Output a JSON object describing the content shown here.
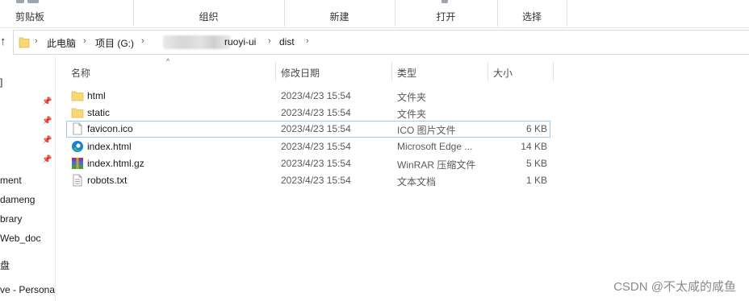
{
  "ribbon": {
    "groups": [
      {
        "label": "剪贴板"
      },
      {
        "label": "组织"
      },
      {
        "label": "新建"
      },
      {
        "label": "打开"
      },
      {
        "label": "选择"
      }
    ]
  },
  "address": {
    "crumbs": [
      "此电脑",
      "项目 (G:)",
      "ruoyi-ui",
      "dist"
    ]
  },
  "navpane": {
    "items": [
      "]",
      "ment",
      "dameng",
      "brary",
      "Web_doc",
      "盘",
      "ve - Persona"
    ]
  },
  "columns": {
    "name": "名称",
    "date": "修改日期",
    "type": "类型",
    "size": "大小"
  },
  "files": [
    {
      "name": "html",
      "date": "2023/4/23 15:54",
      "type": "文件夹",
      "size": "",
      "icon": "folder-icon"
    },
    {
      "name": "static",
      "date": "2023/4/23 15:54",
      "type": "文件夹",
      "size": "",
      "icon": "folder-icon"
    },
    {
      "name": "favicon.ico",
      "date": "2023/4/23 15:54",
      "type": "ICO 图片文件",
      "size": "6 KB",
      "icon": "ico-file-icon"
    },
    {
      "name": "index.html",
      "date": "2023/4/23 15:54",
      "type": "Microsoft Edge ...",
      "size": "14 KB",
      "icon": "edge-icon"
    },
    {
      "name": "index.html.gz",
      "date": "2023/4/23 15:54",
      "type": "WinRAR 压缩文件",
      "size": "5 KB",
      "icon": "winrar-icon"
    },
    {
      "name": "robots.txt",
      "date": "2023/4/23 15:54",
      "type": "文本文档",
      "size": "1 KB",
      "icon": "text-file-icon"
    }
  ],
  "watermark": "CSDN @不太咸的咸鱼",
  "colors": {
    "folder": "#f8d775",
    "focus_border": "#99c9ef",
    "edge_blue": "#1b7fd6",
    "edge_green": "#3ac36b"
  }
}
